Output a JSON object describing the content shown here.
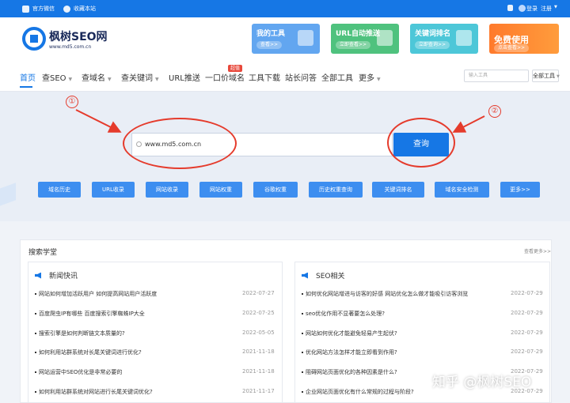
{
  "topbar": {
    "left": [
      "官方微信",
      "收藏本站"
    ],
    "login": "登录",
    "register": "注册"
  },
  "logo": {
    "name": "枫树SEO网",
    "url": "www.md5.com.cn"
  },
  "promos": [
    {
      "title": "我的工具",
      "btn": "查看>>"
    },
    {
      "title": "URL自动推送",
      "btn": "立即查看>>"
    },
    {
      "title": "关键词排名",
      "btn": "立即查询>>"
    },
    {
      "title": "",
      "big": "免费使用",
      "btn": "点击查看>>"
    }
  ],
  "nav": {
    "items": [
      "首页",
      "查SEO",
      "查域名",
      "查关键词",
      "URL推送",
      "一口价域名",
      "工具下载",
      "站长问答",
      "全部工具",
      "更多"
    ],
    "badge": "超值",
    "search_placeholder": "输入工具",
    "all_label": "全部工具"
  },
  "hero": {
    "input_value": "www.md5.com.cn",
    "query_label": "查询",
    "marker1": "①",
    "marker2": "②"
  },
  "tools": [
    "域名历史",
    "URL收录",
    "网站收录",
    "网站权重",
    "谷歌权重",
    "历史权重查询",
    "关键词排名",
    "域名安全检测",
    "更多>>"
  ],
  "content": {
    "title": "搜索学堂",
    "more": "查看更多>>",
    "left": {
      "heading": "新闻快讯",
      "rows": [
        {
          "text": "网站如何增加活跃用户 如何提高网站用户活跃度",
          "date": "2022-07-27"
        },
        {
          "text": "百度爬虫IP有哪些 百度搜索引擎蜘蛛IP大全",
          "date": "2022-07-25"
        },
        {
          "text": "搜索引擎是如何判断链文本质量的?",
          "date": "2022-05-05"
        },
        {
          "text": "如何利用站群系统对长尾关键词进行优化?",
          "date": "2021-11-18"
        },
        {
          "text": "网站运营中SEO优化是非常必要的",
          "date": "2021-11-18"
        },
        {
          "text": "如何利用站群系统对网站进行长尾关键词优化?",
          "date": "2021-11-17"
        }
      ]
    },
    "right": {
      "heading": "SEO相关",
      "rows": [
        {
          "text": "如何优化网站增进与访客的好感 网站优化怎么做才能吸引访客浏览",
          "date": "2022-07-29"
        },
        {
          "text": "seo优化作用不显著要怎么处理?",
          "date": "2022-07-29"
        },
        {
          "text": "网站如何优化才能避免轻易产生起伏?",
          "date": "2022-07-29"
        },
        {
          "text": "优化网站方法怎样才能立即看到作用?",
          "date": "2022-07-29"
        },
        {
          "text": "阻碍网站页面优化的各种因素是什么?",
          "date": "2022-07-29"
        },
        {
          "text": "企业网站页面优化有什么常规的过程与阶段?",
          "date": "2022-07-29"
        }
      ]
    }
  },
  "watermark": "知乎 @枫树SEO",
  "colors": {
    "brand": "#1677e5",
    "annotation": "#e53b2c"
  }
}
